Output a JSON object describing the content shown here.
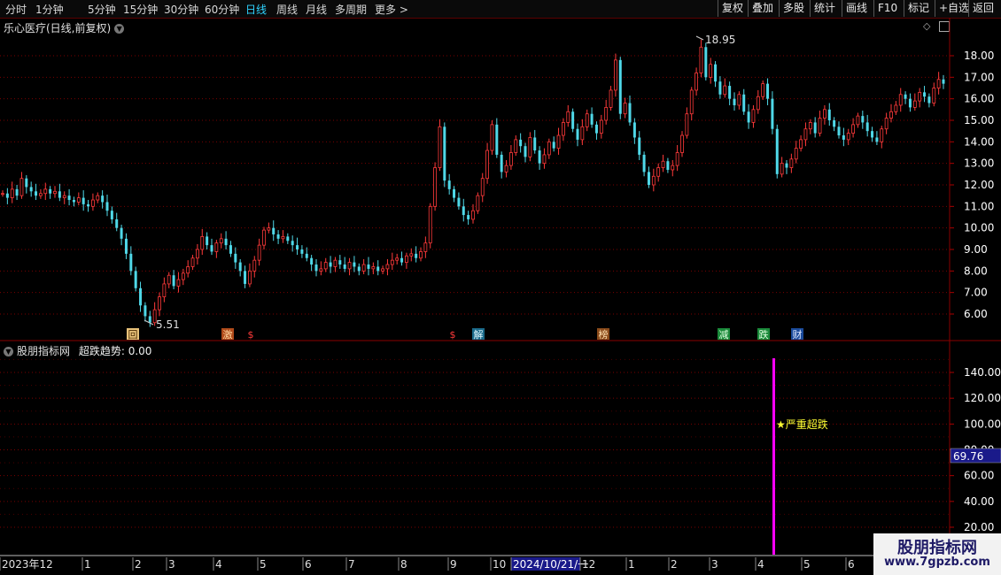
{
  "toolbar": {
    "periods": [
      "分时",
      "1分钟",
      "5分钟",
      "15分钟",
      "30分钟",
      "60分钟",
      "日线",
      "周线",
      "月线",
      "多周期",
      "更多 >"
    ],
    "active_period": "日线",
    "tools": [
      "复权",
      "叠加",
      "多股",
      "统计",
      "画线",
      "F10",
      "标记",
      "+自选",
      "返回"
    ]
  },
  "main_panel": {
    "title": "乐心医疗(日线,前复权)",
    "price_axis": [
      "18.00",
      "17.00",
      "16.00",
      "15.00",
      "14.00",
      "13.00",
      "12.00",
      "11.00",
      "10.00",
      "9.00",
      "8.00",
      "7.00",
      "6.00"
    ],
    "high_label": "18.95",
    "low_label": "5.51",
    "markers": [
      "回",
      "激",
      "$",
      "$",
      "解",
      "榜",
      "减",
      "跌",
      "财"
    ]
  },
  "indicator_panel": {
    "title": "股朋指标网",
    "value_label": "超跌趋势: 0.00",
    "axis": [
      "140.00",
      "120.00",
      "100.00",
      "80.00",
      "60.00",
      "40.00",
      "20.00"
    ],
    "current_value": "69.76",
    "annotation": "★严重超跌"
  },
  "time_axis": {
    "labels": [
      "2023年12",
      "1",
      "2",
      "3",
      "4",
      "5",
      "6",
      "7",
      "8",
      "9",
      "10",
      "2024/10/21/一",
      "12",
      "1",
      "2",
      "3",
      "4",
      "5",
      "6"
    ]
  },
  "watermark": {
    "title": "股朋指标网",
    "url": "www.7gpzb.com"
  },
  "colors": {
    "up": "#ff3a3a",
    "down": "#4fd8e8",
    "grid": "#7a0000",
    "magenta": "#ff00ff",
    "badge": "#1a1a8a"
  },
  "chart_data": {
    "type": "candlestick",
    "y_range": [
      5.3,
      19.3
    ],
    "points": [
      11.6,
      11.4,
      11.8,
      11.5,
      12.3,
      11.9,
      11.7,
      11.5,
      11.6,
      11.8,
      11.6,
      11.7,
      11.4,
      11.5,
      11.3,
      11.2,
      11.4,
      11.1,
      11.0,
      11.3,
      11.5,
      11.2,
      10.8,
      10.4,
      10.0,
      9.5,
      8.8,
      8.0,
      7.2,
      6.4,
      5.9,
      5.6,
      6.2,
      6.8,
      7.4,
      7.8,
      7.3,
      7.6,
      7.9,
      8.2,
      8.6,
      9.0,
      9.6,
      9.2,
      8.9,
      9.3,
      9.5,
      9.2,
      8.8,
      8.4,
      8.0,
      7.4,
      8.0,
      8.5,
      9.2,
      9.9,
      10.0,
      9.7,
      9.5,
      9.6,
      9.4,
      9.2,
      9.0,
      8.8,
      8.6,
      8.3,
      8.0,
      8.1,
      8.4,
      8.2,
      8.5,
      8.3,
      8.1,
      8.4,
      8.2,
      8.0,
      8.3,
      8.1,
      8.2,
      8.0,
      8.1,
      8.3,
      8.5,
      8.6,
      8.4,
      8.7,
      8.8,
      8.6,
      8.9,
      9.3,
      11.0,
      12.8,
      14.7,
      12.2,
      11.8,
      11.4,
      11.0,
      10.6,
      10.4,
      10.8,
      11.5,
      12.3,
      13.6,
      14.8,
      13.4,
      12.6,
      12.9,
      13.5,
      14.1,
      13.8,
      13.3,
      14.2,
      13.6,
      13.0,
      13.4,
      14.0,
      13.7,
      14.3,
      14.9,
      15.4,
      14.6,
      14.1,
      14.7,
      15.3,
      14.8,
      14.4,
      15.0,
      15.6,
      16.4,
      17.8,
      15.3,
      15.8,
      14.9,
      14.2,
      13.4,
      12.6,
      12.0,
      12.4,
      12.8,
      13.1,
      12.7,
      12.9,
      13.5,
      14.3,
      15.3,
      16.4,
      17.2,
      18.4,
      17.0,
      17.6,
      16.8,
      16.2,
      16.6,
      16.0,
      15.7,
      16.2,
      15.4,
      14.9,
      15.5,
      16.1,
      16.7,
      16.0,
      14.6,
      12.5,
      13.0,
      12.8,
      13.2,
      13.7,
      14.1,
      14.6,
      14.9,
      14.4,
      15.1,
      15.5,
      15.0,
      14.7,
      14.3,
      14.1,
      14.4,
      14.8,
      15.2,
      14.9,
      14.5,
      14.2,
      14.0,
      14.6,
      15.1,
      15.4,
      15.7,
      16.2,
      16.0,
      15.6,
      15.9,
      16.3,
      16.1,
      15.8,
      16.5,
      16.9,
      16.7
    ]
  }
}
